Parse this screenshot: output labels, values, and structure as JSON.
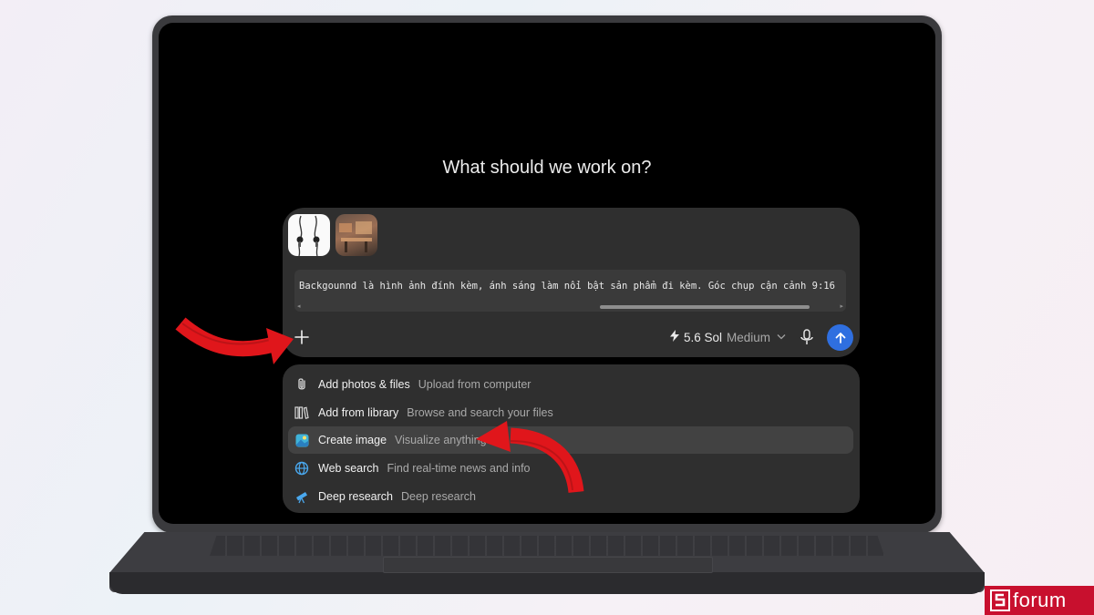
{
  "screen": {
    "headline": "What should we work on?"
  },
  "composer": {
    "attachments": [
      {
        "name": "earbuds-image"
      },
      {
        "name": "room-photo"
      }
    ],
    "prompt_text": "Backgounnd là hình ảnh đính kèm, ánh sáng làm nổi bật sản phẩm đi kèm. Góc chụp cận cảnh 9:16",
    "model_version": "5.6 Sol",
    "model_tier": "Medium",
    "icons": {
      "add": "plus-icon",
      "model": "bolt-icon",
      "mic": "microphone-icon",
      "send": "arrow-up-icon"
    },
    "send_color": "#2f6fe0"
  },
  "menu": {
    "items": [
      {
        "label": "Add photos & files",
        "desc": "Upload from computer",
        "icon": "paperclip-icon",
        "active": false
      },
      {
        "label": "Add from library",
        "desc": "Browse and search your files",
        "icon": "library-icon",
        "active": false
      },
      {
        "label": "Create image",
        "desc": "Visualize anything",
        "icon": "image-icon",
        "active": true
      },
      {
        "label": "Web search",
        "desc": "Find real-time news and info",
        "icon": "globe-icon",
        "active": false
      },
      {
        "label": "Deep research",
        "desc": "Deep research",
        "icon": "telescope-icon",
        "active": false
      }
    ]
  },
  "annotations": {
    "arrow_color": "#e0161b"
  },
  "watermark": {
    "brand": "forum",
    "brand_color": "#c8102e"
  }
}
